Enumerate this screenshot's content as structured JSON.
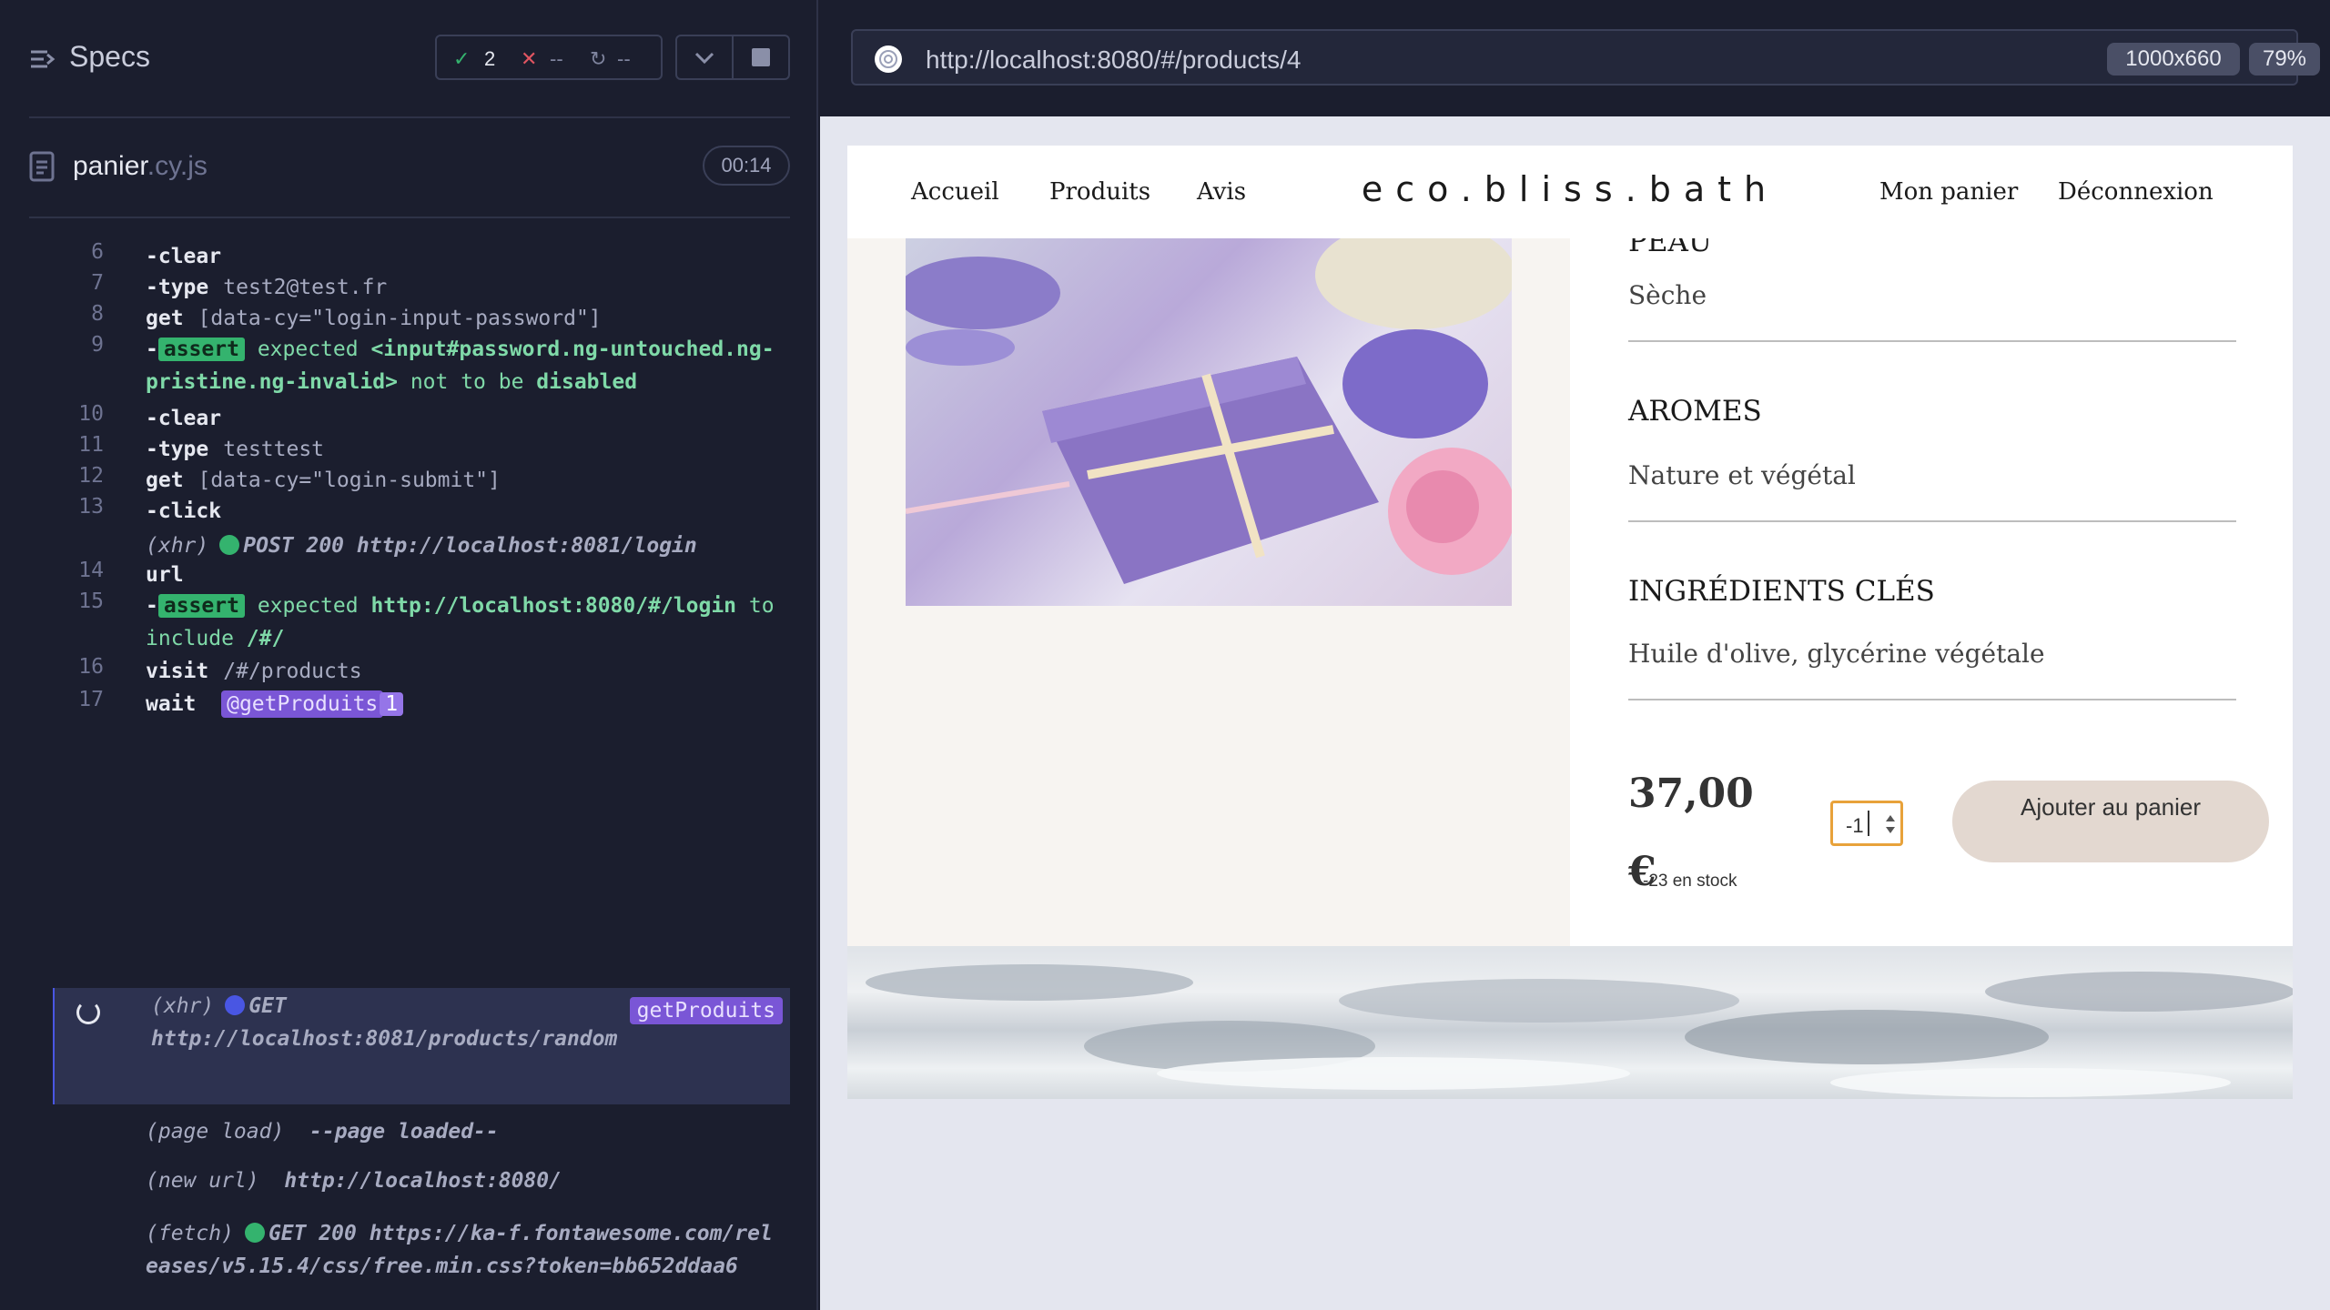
{
  "reporter": {
    "title": "Specs",
    "stats": {
      "passed": "2",
      "failed": "--",
      "pending": "--"
    },
    "file": {
      "name": "panier",
      "ext": ".cy.js"
    },
    "timer": "00:14",
    "commands": [
      {
        "num": "6",
        "name": "-clear"
      },
      {
        "num": "7",
        "name": "-type",
        "arg": "test2@test.fr"
      },
      {
        "num": "8",
        "name": "get",
        "arg": "[data-cy=\"login-input-password\"]"
      },
      {
        "num": "9",
        "prefix": "-",
        "badge": "assert",
        "t1": "expected",
        "t2": "<input#password.ng-untouched.ng-pristine.ng-invalid>",
        "t3": "not to be",
        "t4": "disabled"
      },
      {
        "num": "10",
        "name": "-clear"
      },
      {
        "num": "11",
        "name": "-type",
        "arg": "testtest"
      },
      {
        "num": "12",
        "name": "get",
        "arg": "[data-cy=\"login-submit\"]"
      },
      {
        "num": "13",
        "name": "-click"
      },
      {
        "type": "(xhr)",
        "detail": "POST 200 http://localhost:8081/login"
      },
      {
        "num": "14",
        "name": "url"
      },
      {
        "num": "15",
        "prefix": "-",
        "badge": "assert",
        "t1": "expected",
        "t2": "http://localhost:8080/#/login",
        "t3": "to include",
        "t4": "/#/"
      },
      {
        "num": "16",
        "name": "visit",
        "arg": "/#/products"
      },
      {
        "num": "17",
        "name": "wait",
        "alias": "@getProduits",
        "alias_count": "1"
      },
      {
        "type": "(xhr)",
        "detail": "GET",
        "detail2": "http://localhost:8081/products/random",
        "tag": "getProduits"
      },
      {
        "type": "(page load)",
        "detail": "--page loaded--"
      },
      {
        "type": "(new url)",
        "detail": "http://localhost:8080/"
      },
      {
        "type": "(fetch)",
        "detail": "GET 200 https://ka-f.fontawesome.com/releases/v5.15.4/css/free.min.css?token=bb652ddaa6"
      }
    ]
  },
  "browser": {
    "url": "http://localhost:8080/#/products/4",
    "viewport": "1000x660",
    "zoom": "79%"
  },
  "site": {
    "nav": {
      "home": "Accueil",
      "products": "Produits",
      "reviews": "Avis",
      "logo": "eco.bliss.bath",
      "cart": "Mon panier",
      "logout": "Déconnexion"
    },
    "skin_title": "PEAU",
    "skin_value": "Sèche",
    "aromas_title": "AROMES",
    "aromas_value": "Nature et végétal",
    "ingredients_title": "INGRÉDIENTS CLÉS",
    "ingredients_value": "Huile d'olive, glycérine végétale",
    "price_amount": "37,00",
    "price_currency": "€",
    "stock": "-23 en stock",
    "quantity": "-1",
    "add_button": "Ajouter au panier"
  },
  "colors": {
    "pass": "#34b36e",
    "fail": "#e05561",
    "accent": "#4956e3",
    "alias": "#7a56d6",
    "qty_border": "#e8a23a"
  }
}
